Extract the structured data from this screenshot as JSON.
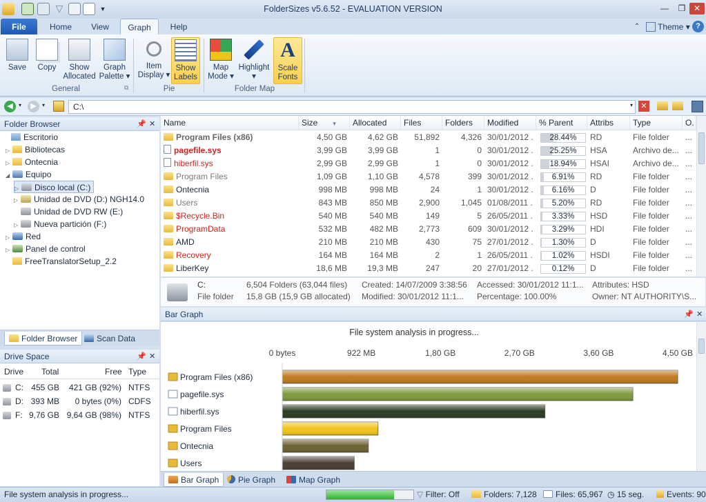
{
  "window": {
    "title": "FolderSizes v5.6.52 - EVALUATION VERSION"
  },
  "tabs": {
    "file": "File",
    "home": "Home",
    "view": "View",
    "graph": "Graph",
    "help": "Help",
    "theme": "Theme"
  },
  "ribbon": {
    "save": "Save",
    "copy": "Copy",
    "show_allocated_1": "Show",
    "show_allocated_2": "Allocated",
    "graph_palette_1": "Graph",
    "graph_palette_2": "Palette ▾",
    "item_display_1": "Item",
    "item_display_2": "Display ▾",
    "show_labels_1": "Show",
    "show_labels_2": "Labels",
    "map_mode_1": "Map",
    "map_mode_2": "Mode ▾",
    "highlight_1": "Highlight",
    "highlight_2": "▾",
    "scale_fonts_1": "Scale",
    "scale_fonts_2": "Fonts",
    "group_general": "General",
    "group_pie": "Pie",
    "group_folder_map": "Folder Map"
  },
  "address": {
    "path": "C:\\"
  },
  "folder_browser": {
    "title": "Folder Browser",
    "nodes": [
      "Escritorio",
      "Bibliotecas",
      "Ontecnia",
      "Equipo",
      "Disco local (C:)",
      "Unidad de DVD (D:) NGH14.0",
      "Unidad de DVD RW (E:)",
      "Nueva partición (F:)",
      "Red",
      "Panel de control",
      "FreeTranslatorSetup_2.2"
    ],
    "tab_browser": "Folder Browser",
    "tab_scan": "Scan Data"
  },
  "drive_space": {
    "title": "Drive Space",
    "headers": [
      "Drive",
      "Total",
      "Free",
      "Type"
    ],
    "rows": [
      {
        "drive": "C:",
        "total": "455 GB",
        "free": "421 GB (92%)",
        "type": "NTFS"
      },
      {
        "drive": "D:",
        "total": "393 MB",
        "free": "0 bytes (0%)",
        "type": "CDFS"
      },
      {
        "drive": "F:",
        "total": "9,76 GB",
        "free": "9,64 GB (98%)",
        "type": "NTFS"
      }
    ]
  },
  "list": {
    "headers": [
      "Name",
      "Size",
      "Allocated",
      "Files",
      "Folders",
      "Modified",
      "% Parent",
      "Attribs",
      "Type",
      "O."
    ],
    "rows": [
      {
        "name": "Program Files (x86)",
        "size": "4,50 GB",
        "alloc": "4,62 GB",
        "files": "51,892",
        "folders": "4,326",
        "mod": "30/01/2012 ...",
        "pct": "28.44%",
        "pctv": 28.44,
        "attr": "RD",
        "type": "File folder",
        "o": "...",
        "style": "gray-bold",
        "icon": "folder"
      },
      {
        "name": "pagefile.sys",
        "size": "3,99 GB",
        "alloc": "3,99 GB",
        "files": "1",
        "folders": "0",
        "mod": "30/01/2012 ...",
        "pct": "25.25%",
        "pctv": 25.25,
        "attr": "HSA",
        "type": "Archivo de...",
        "o": "...",
        "style": "red-bold",
        "icon": "file"
      },
      {
        "name": "hiberfil.sys",
        "size": "2,99 GB",
        "alloc": "2,99 GB",
        "files": "1",
        "folders": "0",
        "mod": "30/01/2012 ...",
        "pct": "18.94%",
        "pctv": 18.94,
        "attr": "HSAI",
        "type": "Archivo de...",
        "o": "...",
        "style": "red",
        "icon": "file"
      },
      {
        "name": "Program Files",
        "size": "1,09 GB",
        "alloc": "1,10 GB",
        "files": "4,578",
        "folders": "399",
        "mod": "30/01/2012 ...",
        "pct": "6.91%",
        "pctv": 6.91,
        "attr": "RD",
        "type": "File folder",
        "o": "...",
        "style": "gray",
        "icon": "folder"
      },
      {
        "name": "Ontecnia",
        "size": "998 MB",
        "alloc": "998 MB",
        "files": "24",
        "folders": "1",
        "mod": "30/01/2012 ...",
        "pct": "6.16%",
        "pctv": 6.16,
        "attr": "D",
        "type": "File folder",
        "o": "...",
        "style": "normal",
        "icon": "folder"
      },
      {
        "name": "Users",
        "size": "843 MB",
        "alloc": "850 MB",
        "files": "2,900",
        "folders": "1,045",
        "mod": "01/08/2011 ...",
        "pct": "5.20%",
        "pctv": 5.2,
        "attr": "RD",
        "type": "File folder",
        "o": "...",
        "style": "gray",
        "icon": "folder"
      },
      {
        "name": "$Recycle.Bin",
        "size": "540 MB",
        "alloc": "540 MB",
        "files": "149",
        "folders": "5",
        "mod": "26/05/2011 ...",
        "pct": "3.33%",
        "pctv": 3.33,
        "attr": "HSD",
        "type": "File folder",
        "o": "...",
        "style": "red",
        "icon": "folder"
      },
      {
        "name": "ProgramData",
        "size": "532 MB",
        "alloc": "482 MB",
        "files": "2,773",
        "folders": "609",
        "mod": "30/01/2012 ...",
        "pct": "3.29%",
        "pctv": 3.29,
        "attr": "HDI",
        "type": "File folder",
        "o": "...",
        "style": "red",
        "icon": "folder"
      },
      {
        "name": "AMD",
        "size": "210 MB",
        "alloc": "210 MB",
        "files": "430",
        "folders": "75",
        "mod": "27/01/2012 ...",
        "pct": "1.30%",
        "pctv": 1.3,
        "attr": "D",
        "type": "File folder",
        "o": "...",
        "style": "normal",
        "icon": "folder"
      },
      {
        "name": "Recovery",
        "size": "164 MB",
        "alloc": "164 MB",
        "files": "2",
        "folders": "1",
        "mod": "26/05/2011 ...",
        "pct": "1.02%",
        "pctv": 1.02,
        "attr": "HSDI",
        "type": "File folder",
        "o": "...",
        "style": "red",
        "icon": "folder"
      },
      {
        "name": "LiberKey",
        "size": "18,6 MB",
        "alloc": "19,3 MB",
        "files": "247",
        "folders": "20",
        "mod": "27/01/2012 ...",
        "pct": "0.12%",
        "pctv": 0.12,
        "attr": "D",
        "type": "File folder",
        "o": "...",
        "style": "normal",
        "icon": "folder"
      }
    ]
  },
  "info": {
    "drive": "C:",
    "kind": "File folder",
    "counts": "6,504 Folders (63,044 files)",
    "size": "15,8 GB (15,9 GB allocated)",
    "created": "Created: 14/07/2009 3:38:56",
    "modified": "Modified: 30/01/2012 11:1...",
    "accessed": "Accessed: 30/01/2012 11:1...",
    "percentage": "Percentage: 100.00%",
    "attributes": "Attributes: HSD",
    "owner": "Owner: NT AUTHORITY\\S..."
  },
  "bar_graph": {
    "panel_title": "Bar Graph",
    "tab_bar": "Bar Graph",
    "tab_pie": "Pie Graph",
    "tab_map": "Map Graph"
  },
  "chart_data": {
    "type": "bar",
    "title": "File system analysis in progress...",
    "orientation": "horizontal",
    "xlim": [
      0,
      4.5
    ],
    "x_unit": "GB",
    "ticks": [
      "0 bytes",
      "922 MB",
      "1,80 GB",
      "2,70 GB",
      "3,60 GB",
      "4,50 GB"
    ],
    "categories": [
      "Program Files (x86)",
      "pagefile.sys",
      "hiberfil.sys",
      "Program Files",
      "Ontecnia",
      "Users"
    ],
    "values": [
      4.5,
      3.99,
      2.99,
      1.09,
      0.98,
      0.82
    ],
    "colors": [
      "#c07a1e",
      "#7f9a3e",
      "#2b3a22",
      "#f2c418",
      "#6d6230",
      "#4a3e33"
    ]
  },
  "status": {
    "text": "File system analysis in progress...",
    "progress": 0.78,
    "filter": "Filter: Off",
    "folders": "Folders: 7,128",
    "files": "Files: 65,967",
    "time": "15 seg.",
    "events": "Events: 90"
  }
}
